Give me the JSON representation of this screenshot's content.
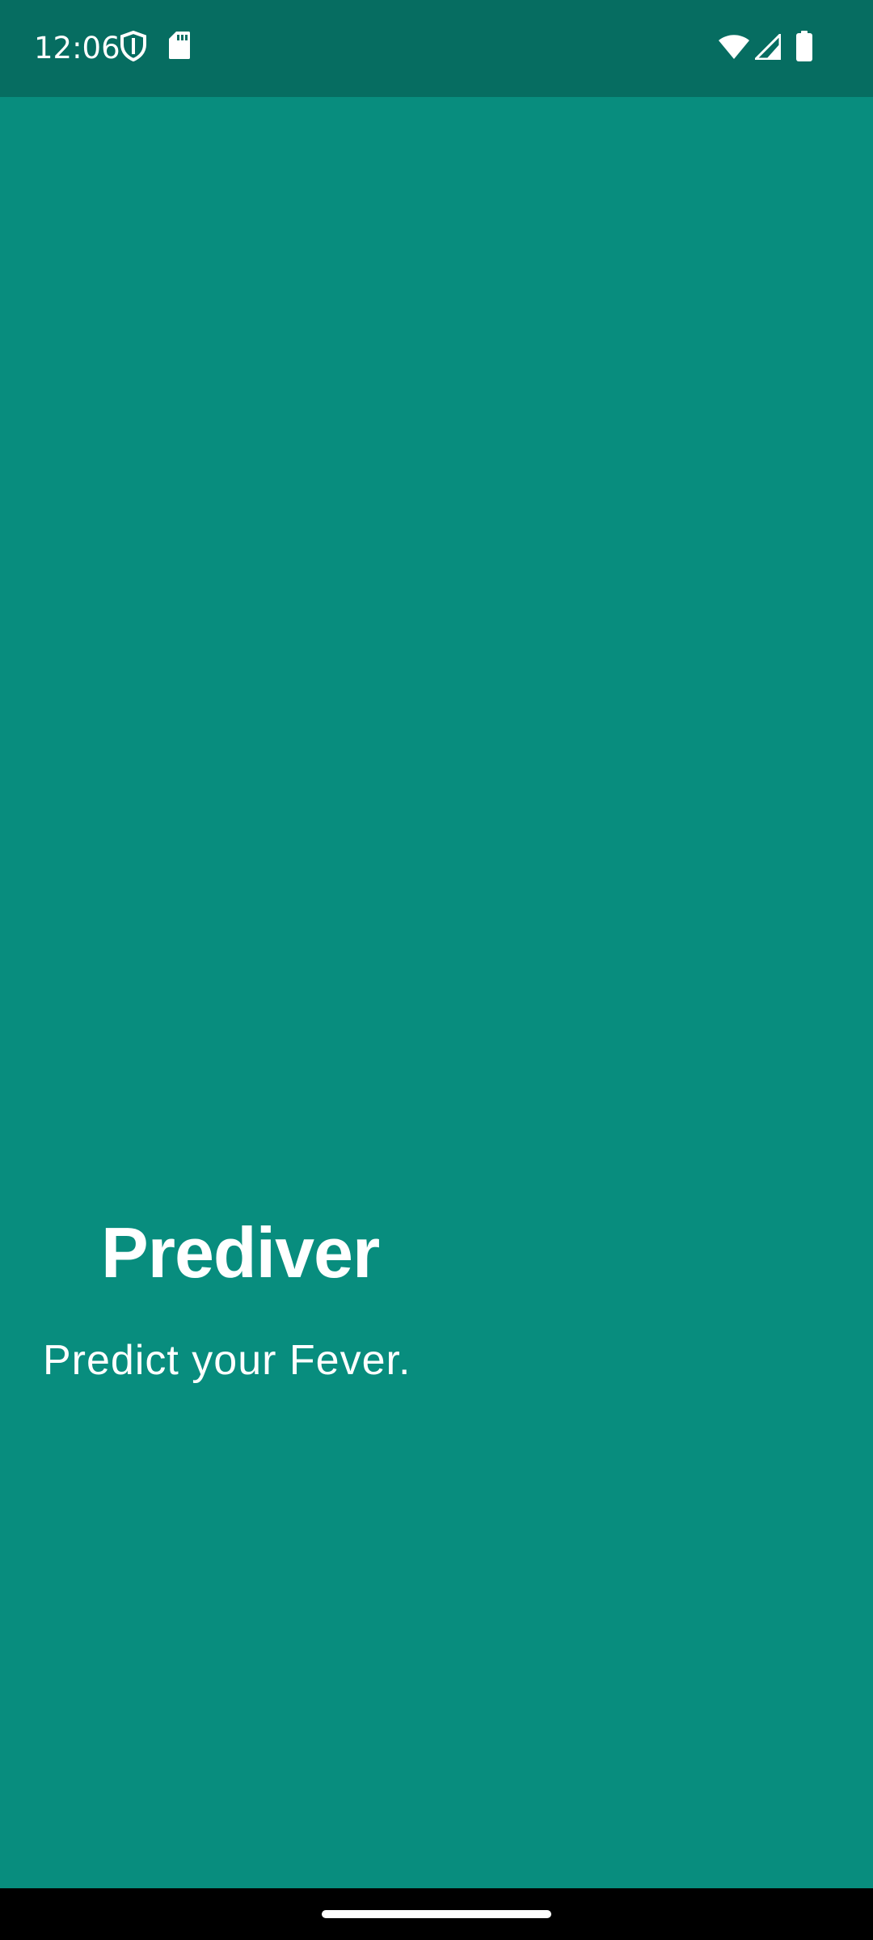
{
  "status_bar": {
    "time": "12:06",
    "icons": [
      "shield-icon",
      "sd-card-icon",
      "wifi-icon",
      "cellular-signal-icon",
      "battery-icon"
    ]
  },
  "app": {
    "title": "Prediver",
    "subtitle": "Predict your Fever."
  },
  "colors": {
    "status_bar": "#066d61",
    "background": "#088d7e",
    "text": "#ffffff",
    "nav_bar": "#000000"
  }
}
